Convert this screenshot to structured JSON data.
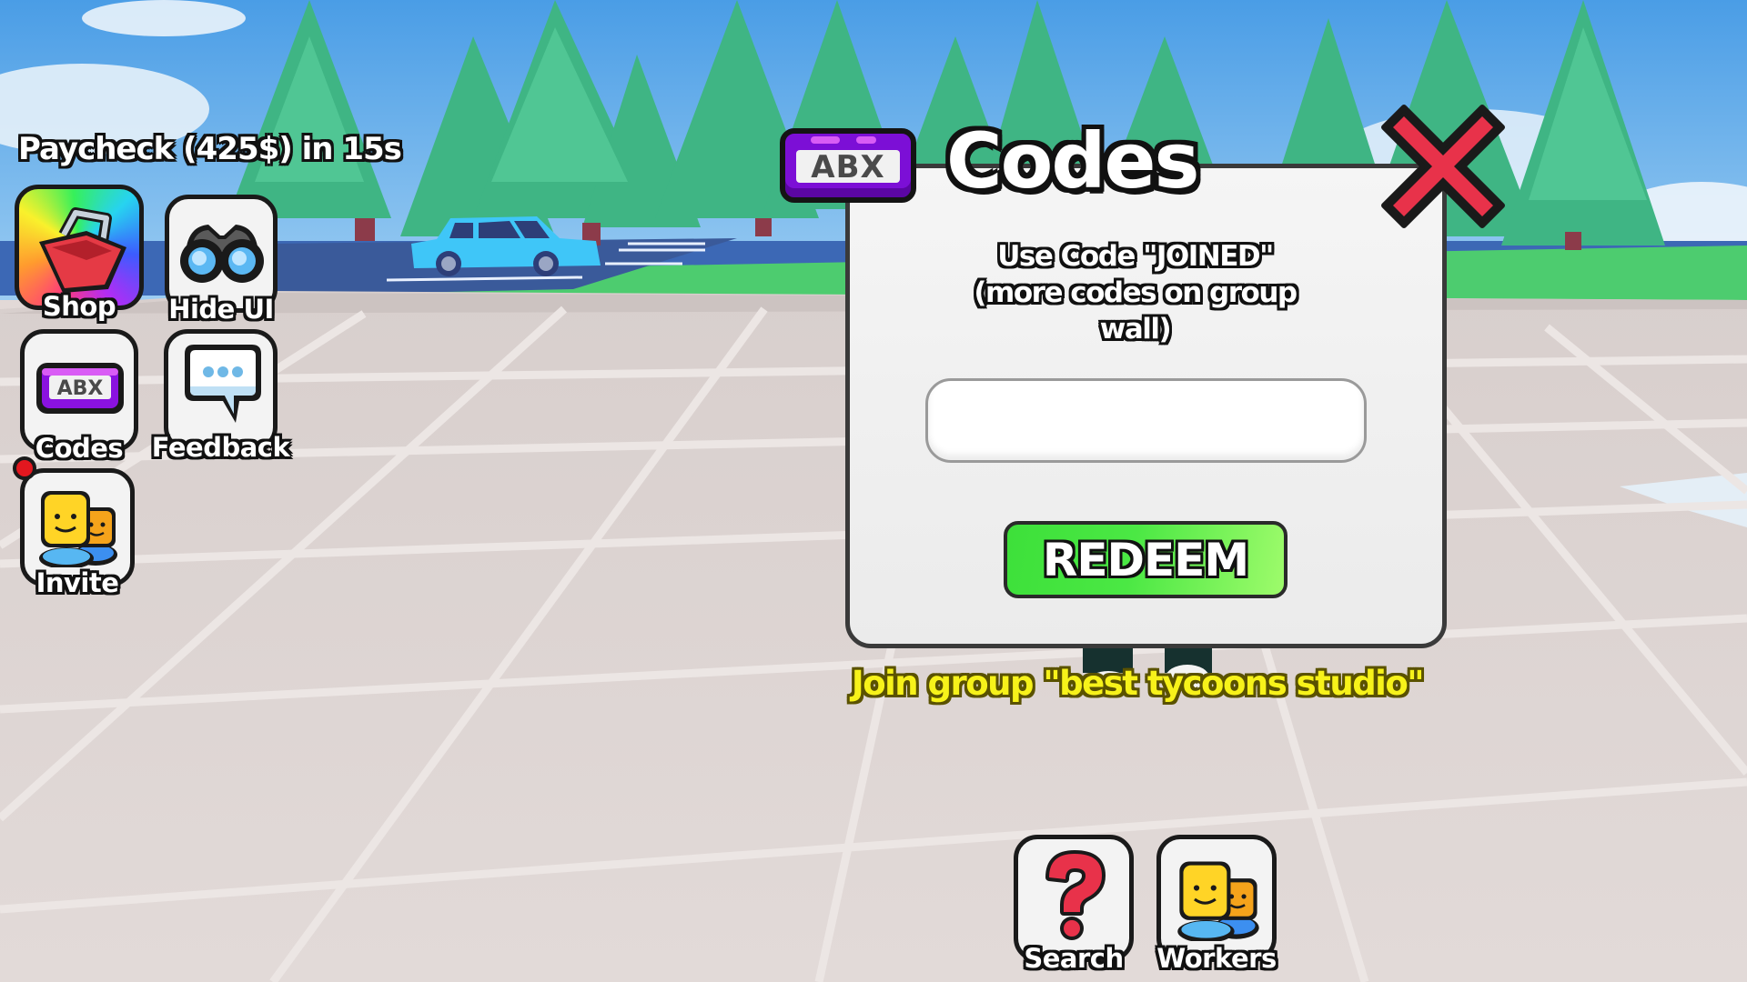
{
  "hud": {
    "paycheck_text": "Paycheck (425$) in 15s",
    "buttons": {
      "shop": {
        "label": "Shop",
        "icon": "basket-icon"
      },
      "hide_ui": {
        "label": "Hide UI",
        "icon": "binoculars-icon"
      },
      "codes": {
        "label": "Codes",
        "icon": "abx-ticket-icon"
      },
      "feedback": {
        "label": "Feedback",
        "icon": "speech-bubble-icon"
      },
      "invite": {
        "label": "Invite",
        "icon": "two-people-icon",
        "has_notification": true
      }
    },
    "bottom_buttons": {
      "search": {
        "label": "Search",
        "icon": "question-mark-icon"
      },
      "workers": {
        "label": "Workers",
        "icon": "two-people-icon"
      }
    }
  },
  "codes_panel": {
    "badge_text": "ABX",
    "title": "Codes",
    "instructions_line1": "Use Code  \"JOINED\"",
    "instructions_line2": "(more codes on group",
    "instructions_line3": "wall)",
    "input_value": "",
    "input_placeholder": "",
    "redeem_label": "REDEEM",
    "close_icon": "close-x-icon"
  },
  "footer_message": "Join group \"best tycoons studio\"",
  "colors": {
    "accent_purple": "#7c0fd6",
    "redeem_green": "#4be844",
    "close_red": "#e8324a",
    "join_text_yellow": "#f7f21a",
    "notification_red": "#e3171f"
  }
}
